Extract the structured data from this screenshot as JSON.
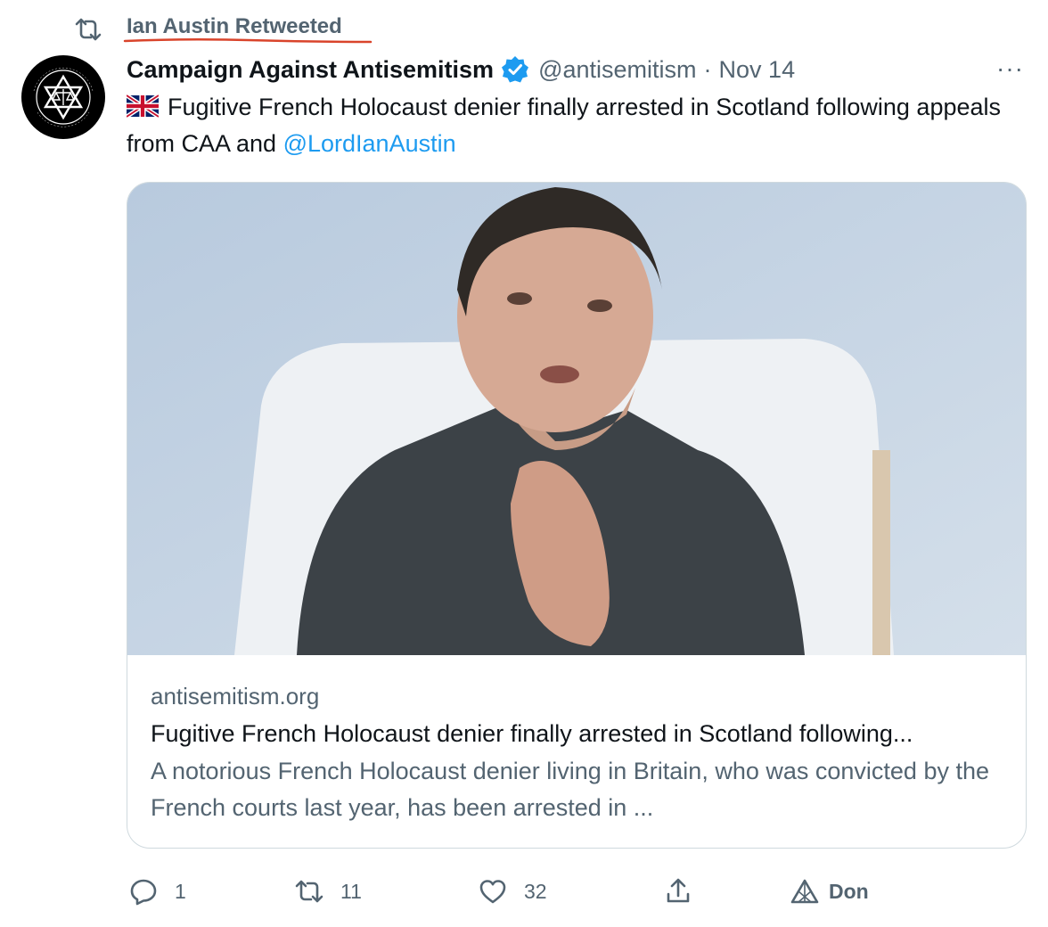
{
  "retweet": {
    "label": "Ian Austin Retweeted"
  },
  "tweet": {
    "author_name": "Campaign Against Antisemitism",
    "handle": "@antisemitism",
    "separator": "·",
    "date": "Nov 14",
    "more_label": "···",
    "text": "Fugitive French Holocaust denier finally arrested in Scotland following appeals from CAA and",
    "mention": "@LordIanAustin",
    "avatar": {
      "ring_text": "CAMPAIGN AGAINST",
      "bottom_text": "ANTISEMITISM"
    }
  },
  "card": {
    "domain": "antisemitism.org",
    "title": "Fugitive French Holocaust denier finally arrested in Scotland following...",
    "description": "A notorious French Holocaust denier living in Britain, who was convicted by the French courts last year, has been arrested in ..."
  },
  "actions": {
    "replies": "1",
    "retweets": "11",
    "likes": "32",
    "donate_label": "Don"
  },
  "colors": {
    "accent": "#1d9bf0",
    "muted": "#536471",
    "underline": "#d9442b"
  },
  "icons": [
    "retweet-icon",
    "verified-icon",
    "uk-flag-icon",
    "more-icon",
    "reply-icon",
    "like-icon",
    "share-icon",
    "donate-icon"
  ]
}
